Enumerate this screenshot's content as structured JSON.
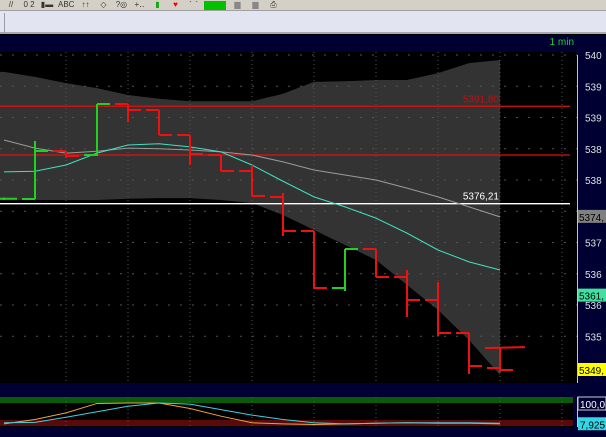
{
  "toolbar": {
    "items": [
      {
        "icon": "draw-line-icon",
        "label": "//"
      },
      {
        "icon": "numbers-icon",
        "label": "0 2"
      },
      {
        "icon": "bar-color-icon",
        "label": "▮▬"
      },
      {
        "icon": "text-icon",
        "label": "ABC"
      },
      {
        "icon": "arrows-icon",
        "label": "↑↑"
      },
      {
        "icon": "diamond-icon",
        "label": "◇"
      },
      {
        "icon": "fire-icon",
        "label": "?◎"
      },
      {
        "icon": "crosshair-icon",
        "label": "+‥"
      },
      {
        "icon": "green-bar-icon",
        "label": "▮"
      },
      {
        "icon": "heart-icon",
        "label": "♥"
      },
      {
        "icon": "chart-icon",
        "label": "⌒"
      },
      {
        "icon": "color-picker-icon",
        "label": ""
      },
      {
        "icon": "layer-back-icon",
        "label": "▆"
      },
      {
        "icon": "layer-front-icon",
        "label": "▆"
      },
      {
        "icon": "print-icon",
        "label": "⎙"
      }
    ],
    "color_swatch": "#00c000"
  },
  "header": {
    "timeframe": "1 min"
  },
  "price_axis": {
    "labels": [
      "540",
      "539",
      "539",
      "538",
      "538",
      "537",
      "536",
      "536",
      "535"
    ],
    "tags": [
      {
        "text": "5374,",
        "price": 5374.1,
        "color": "#808080"
      },
      {
        "text": "5361,",
        "price": 5361.5,
        "color": "#40e0a0"
      },
      {
        "text": "5349,",
        "price": 5349.6,
        "color": "#ffff00"
      }
    ]
  },
  "osc_axis": {
    "tags": [
      {
        "text": "100,0",
        "value": 100,
        "color": "#000032"
      },
      {
        "text": "7,925",
        "value": 7.925,
        "color": "#33d6e6"
      }
    ]
  },
  "colors": {
    "up": "#22d022",
    "down": "#ee1111",
    "band": "#333333",
    "ma": "#9a9a9a",
    "fast": "#40e0c0",
    "osc1": "#f0a040",
    "osc2": "#40d0e0"
  },
  "chart_data": {
    "type": "ohlc",
    "timeframe": "1 min",
    "ylim": [
      5347,
      5408
    ],
    "yticks": [
      5400,
      5395,
      5390,
      5385,
      5380,
      5375,
      5370,
      5365,
      5360,
      5355
    ],
    "hlines": [
      {
        "price": 5391.8,
        "label": "5391,80",
        "color": "#dd1111"
      },
      {
        "price": 5384.0,
        "label": "",
        "color": "#dd1111"
      },
      {
        "price": 5376.21,
        "label": "5376,21",
        "color": "#ffffff"
      }
    ],
    "bars": [
      {
        "o": 5377.0,
        "h": 5377.2,
        "l": 5376.8,
        "c": 5377.0
      },
      {
        "o": 5376.96,
        "h": 5386.24,
        "l": 5376.96,
        "c": 5384.64
      },
      {
        "o": 5384.64,
        "h": 5384.64,
        "l": 5383.52,
        "c": 5383.84
      },
      {
        "o": 5384.0,
        "h": 5392.16,
        "l": 5383.84,
        "c": 5392.16
      },
      {
        "o": 5392.16,
        "h": 5392.16,
        "l": 5389.28,
        "c": 5391.2
      },
      {
        "o": 5391.2,
        "h": 5391.2,
        "l": 5387.2,
        "c": 5387.2
      },
      {
        "o": 5387.2,
        "h": 5387.2,
        "l": 5382.4,
        "c": 5384.16
      },
      {
        "o": 5384.0,
        "h": 5384.0,
        "l": 5381.44,
        "c": 5381.44
      },
      {
        "o": 5381.44,
        "h": 5382.4,
        "l": 5377.44,
        "c": 5377.44
      },
      {
        "o": 5377.28,
        "h": 5377.92,
        "l": 5371.04,
        "c": 5371.84
      },
      {
        "o": 5371.84,
        "h": 5371.84,
        "l": 5362.56,
        "c": 5362.72
      },
      {
        "o": 5362.72,
        "h": 5368.96,
        "l": 5362.24,
        "c": 5368.96
      },
      {
        "o": 5368.96,
        "h": 5368.96,
        "l": 5364.48,
        "c": 5364.48
      },
      {
        "o": 5364.48,
        "h": 5365.6,
        "l": 5358.08,
        "c": 5360.8
      },
      {
        "o": 5360.8,
        "h": 5363.68,
        "l": 5355.04,
        "c": 5355.52
      },
      {
        "o": 5355.52,
        "h": 5355.52,
        "l": 5348.96,
        "c": 5350.24
      },
      {
        "o": 5349.92,
        "h": 5353.12,
        "l": 5349.28,
        "c": 5349.6
      }
    ],
    "last_price": 5353.1,
    "band_upper": [
      5397.3,
      5396.5,
      5395.5,
      5394.7,
      5393.6,
      5393.0,
      5392.6,
      5392.6,
      5392.6,
      5393.8,
      5395.7,
      5395.8,
      5396.0,
      5396.0,
      5397.1,
      5398.7,
      5399.2
    ],
    "band_lower": [
      5376.8,
      5376.8,
      5376.8,
      5376.8,
      5377.0,
      5377.1,
      5377.1,
      5376.8,
      5376.3,
      5374.4,
      5372.0,
      5369.6,
      5367.2,
      5363.2,
      5359.2,
      5354.4,
      5348.8
    ],
    "ma_slow": [
      5386.4,
      5385.1,
      5384.3,
      5384.6,
      5385.1,
      5385.0,
      5384.8,
      5384.5,
      5384.0,
      5382.9,
      5381.6,
      5380.8,
      5380.0,
      5378.7,
      5377.3,
      5375.7,
      5374.1
    ],
    "ma_fast": [
      5381.3,
      5381.4,
      5382.4,
      5384.3,
      5385.6,
      5385.8,
      5385.3,
      5384.5,
      5382.4,
      5379.8,
      5377.3,
      5375.7,
      5373.9,
      5371.5,
      5368.8,
      5366.9,
      5365.6
    ],
    "oscillator": {
      "ylim": [
        0,
        100
      ],
      "series": [
        {
          "name": "osc1",
          "values": [
            5,
            25,
            55,
            98,
            100,
            100,
            75,
            40,
            10,
            5,
            2,
            5,
            8,
            10,
            8,
            8,
            5
          ]
        },
        {
          "name": "osc2",
          "values": [
            10,
            12,
            35,
            60,
            85,
            100,
            95,
            70,
            45,
            25,
            10,
            5,
            8,
            10,
            10,
            10,
            8
          ]
        }
      ]
    }
  }
}
